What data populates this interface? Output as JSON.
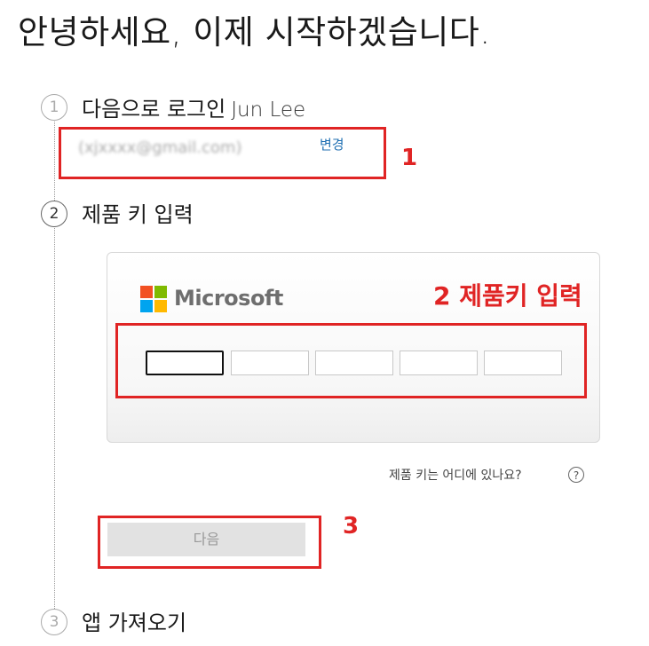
{
  "heading": "안녕하세요, 이제 시작하겠습니다.",
  "steps": [
    {
      "number": "1",
      "label": "다음으로 로그인",
      "user_name": "Jun Lee"
    },
    {
      "number": "2",
      "label": "제품 키 입력"
    },
    {
      "number": "3",
      "label": "앱 가져오기"
    }
  ],
  "account": {
    "email_blurred": "(xjxxxx@gmail.com)",
    "change_link": "변경"
  },
  "product_key": {
    "brand": "Microsoft",
    "logo_colors": [
      "#f25022",
      "#7fba00",
      "#00a4ef",
      "#ffb900"
    ],
    "segments": [
      "",
      "",
      "",
      "",
      ""
    ],
    "help_text": "제품 키는 어디에 있나요?",
    "help_icon": "question-icon"
  },
  "next_button": "다음",
  "annotations": {
    "label_1": "1",
    "label_2": "2 제품키 입력",
    "label_3": "3",
    "color": "#e02424"
  }
}
